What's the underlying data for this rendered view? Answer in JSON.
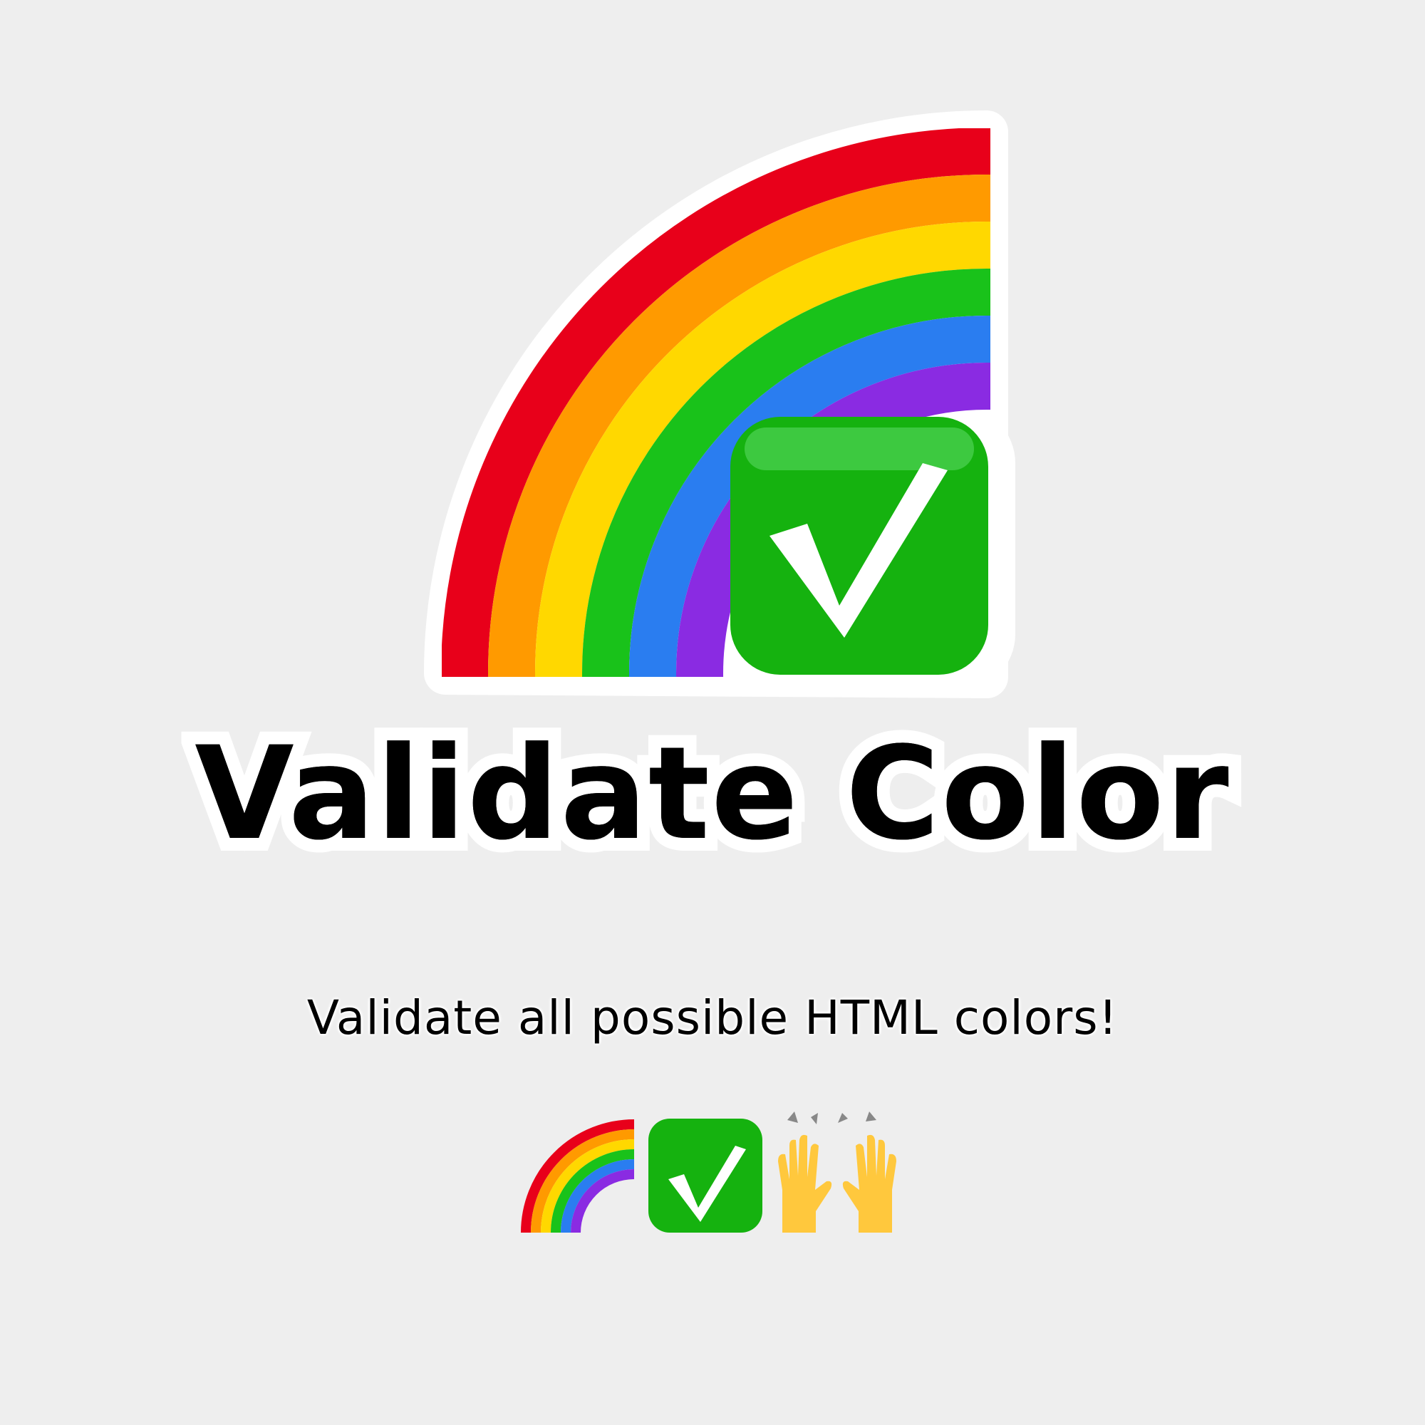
{
  "logo": {
    "icons": [
      "rainbow-icon",
      "check-mark-button-icon"
    ],
    "rainbow_colors": [
      "#e8001a",
      "#ff9a00",
      "#ffd800",
      "#19c21a",
      "#2a7df0",
      "#8a2be2"
    ],
    "check_color": "#15b20f",
    "outline_color": "#ffffff"
  },
  "title": "Validate Color",
  "subtitle": "Validate all possible HTML colors!",
  "emoji_row": [
    "rainbow-icon",
    "check-mark-button-icon",
    "raising-hands-icon"
  ],
  "colors": {
    "background": "#eeeeee",
    "text": "#000000"
  }
}
